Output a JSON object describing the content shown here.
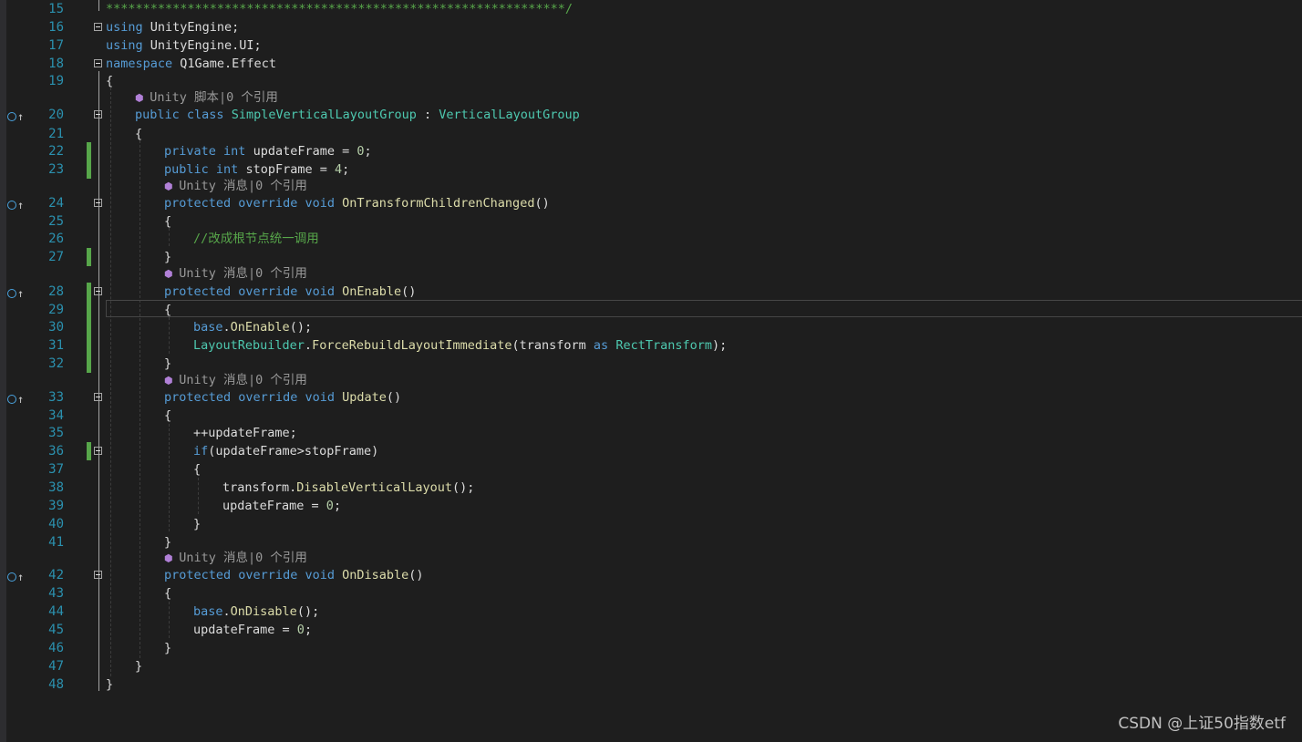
{
  "editor": {
    "lines": [
      {
        "n": "15",
        "text": "**************************************************************/"
      },
      {
        "n": "16",
        "kw": "using",
        "rest": " UnityEngine;"
      },
      {
        "n": "17",
        "kw": "using",
        "rest": " UnityEngine.UI;"
      },
      {
        "n": "18",
        "kw": "namespace",
        "rest": " Q1Game.Effect"
      },
      {
        "n": "19",
        "text": "{"
      },
      {
        "lens": "Unity 脚本|0 个引用"
      },
      {
        "n": "20",
        "kw1": "public",
        "kw2": "class",
        "cls": "SimpleVerticalLayoutGroup",
        "sep": " : ",
        "base": "VerticalLayoutGroup"
      },
      {
        "n": "21",
        "text": "{"
      },
      {
        "n": "22",
        "kw1": "private",
        "kw2": "int",
        "rest": " updateFrame = ",
        "val": "0",
        "end": ";"
      },
      {
        "n": "23",
        "kw1": "public",
        "kw2": "int",
        "rest": " stopFrame = ",
        "val": "4",
        "end": ";"
      },
      {
        "lens": "Unity 消息|0 个引用"
      },
      {
        "n": "24",
        "kw1": "protected",
        "kw2": "override",
        "kw3": "void",
        "fn": "OnTransformChildrenChanged",
        "end": "()"
      },
      {
        "n": "25",
        "text": "{"
      },
      {
        "n": "26",
        "comment": "//改成根节点统一调用"
      },
      {
        "n": "27",
        "text": "}"
      },
      {
        "lens": "Unity 消息|0 个引用"
      },
      {
        "n": "28",
        "kw1": "protected",
        "kw2": "override",
        "kw3": "void",
        "fn": "OnEnable",
        "end": "()"
      },
      {
        "n": "29",
        "text": "{"
      },
      {
        "n": "30",
        "kw": "base",
        "rest": ".",
        "fn": "OnEnable",
        "end": "();"
      },
      {
        "n": "31",
        "ty": "LayoutRebuilder",
        "rest": ".",
        "fn": "ForceRebuildLayoutImmediate",
        "mid": "(transform ",
        "kw": "as",
        "ty2": " RectTransform",
        "end": ");"
      },
      {
        "n": "32",
        "text": "}"
      },
      {
        "lens": "Unity 消息|0 个引用"
      },
      {
        "n": "33",
        "kw1": "protected",
        "kw2": "override",
        "kw3": "void",
        "fn": "Update",
        "end": "()"
      },
      {
        "n": "34",
        "text": "{"
      },
      {
        "n": "35",
        "text": "++updateFrame;"
      },
      {
        "n": "36",
        "kw": "if",
        "rest": "(updateFrame>stopFrame)"
      },
      {
        "n": "37",
        "text": "{"
      },
      {
        "n": "38",
        "pre": "transform.",
        "fn": "DisableVerticalLayout",
        "end": "();"
      },
      {
        "n": "39",
        "rest": "updateFrame = ",
        "val": "0",
        "end": ";"
      },
      {
        "n": "40",
        "text": "}"
      },
      {
        "n": "41",
        "text": "}"
      },
      {
        "lens": "Unity 消息|0 个引用"
      },
      {
        "n": "42",
        "kw1": "protected",
        "kw2": "override",
        "kw3": "void",
        "fn": "OnDisable",
        "end": "()"
      },
      {
        "n": "43",
        "text": "{"
      },
      {
        "n": "44",
        "kw": "base",
        "rest": ".",
        "fn": "OnDisable",
        "end": "();"
      },
      {
        "n": "45",
        "rest": "updateFrame = ",
        "val": "0",
        "end": ";"
      },
      {
        "n": "46",
        "text": "}"
      },
      {
        "n": "47",
        "text": "}"
      },
      {
        "n": "48",
        "text": "}"
      }
    ]
  },
  "watermark": "CSDN @上证50指数etf",
  "colors": {
    "background": "#1e1e1e",
    "keyword": "#569cd6",
    "type": "#4ec9b0",
    "method": "#dcdcaa",
    "comment": "#57a64a",
    "number": "#b5cea8",
    "line_number": "#2b91af",
    "change_bar": "#57a64a"
  },
  "icons": {
    "glyph_20": "class-override-icon",
    "glyph_method": "method-override-icon",
    "lens": "unity-cube-icon",
    "fold": "fold-collapse-icon"
  }
}
